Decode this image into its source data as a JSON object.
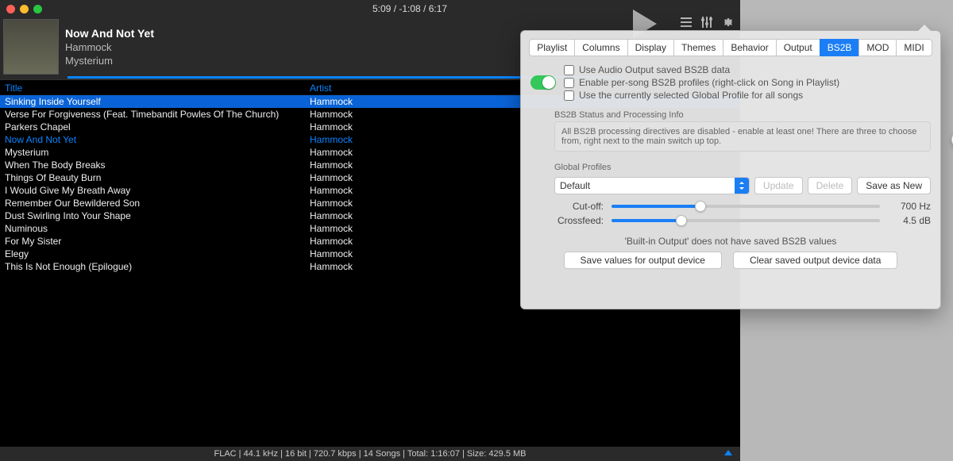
{
  "titlebar": {
    "time_display": "5:09 / -1:08 / 6:17"
  },
  "toolbar_icons": {
    "play": "play-icon",
    "playlist": "list-icon",
    "eq": "equalizer-icon",
    "gear": "gear-icon"
  },
  "now_playing": {
    "title": "Now And Not Yet",
    "artist": "Hammock",
    "album": "Mysterium",
    "progress_pct": 82
  },
  "columns": {
    "title": "Title",
    "artist": "Artist"
  },
  "playlist": [
    {
      "title": "Sinking Inside Yourself",
      "artist": "Hammock",
      "selected": true
    },
    {
      "title": "Verse For Forgiveness (Feat. Timebandit Powles Of The Church)",
      "artist": "Hammock"
    },
    {
      "title": "Parkers Chapel",
      "artist": "Hammock"
    },
    {
      "title": "Now And Not Yet",
      "artist": "Hammock",
      "now_playing": true
    },
    {
      "title": "Mysterium",
      "artist": "Hammock"
    },
    {
      "title": "When The Body Breaks",
      "artist": "Hammock"
    },
    {
      "title": "Things Of Beauty Burn",
      "artist": "Hammock"
    },
    {
      "title": "I Would Give My Breath Away",
      "artist": "Hammock"
    },
    {
      "title": "Remember Our Bewildered Son",
      "artist": "Hammock"
    },
    {
      "title": "Dust Swirling Into Your Shape",
      "artist": "Hammock"
    },
    {
      "title": "Numinous",
      "artist": "Hammock"
    },
    {
      "title": "For My Sister",
      "artist": "Hammock"
    },
    {
      "title": "Elegy",
      "artist": "Hammock"
    },
    {
      "title": "This Is Not Enough  (Epilogue)",
      "artist": "Hammock"
    }
  ],
  "status_bar": "FLAC | 44.1 kHz | 16 bit | 720.7 kbps | 14 Songs | Total: 1:16:07 | Size: 429.5 MB",
  "prefs": {
    "tabs": [
      "Playlist",
      "Columns",
      "Display",
      "Themes",
      "Behavior",
      "Output",
      "BS2B",
      "MOD",
      "MIDI"
    ],
    "active_tab": "BS2B",
    "master_toggle": true,
    "opts": {
      "use_saved": "Use Audio Output saved BS2B data",
      "per_song": "Enable per-song BS2B profiles (right-click on Song in Playlist)",
      "use_global": "Use the currently selected Global Profile for all songs"
    },
    "status_section_label": "BS2B Status and Processing Info",
    "status_info": "All BS2B processing directives are disabled - enable at least one! There are three to choose from, right next to the main switch up top.",
    "profiles_label": "Global Profiles",
    "profile_selected": "Default",
    "buttons": {
      "update": "Update",
      "delete": "Delete",
      "save_new": "Save as New",
      "save_device": "Save values for output device",
      "clear_device": "Clear saved output device data"
    },
    "sliders": {
      "cutoff": {
        "label": "Cut-off:",
        "value": "700 Hz",
        "pct": 33
      },
      "crossfeed": {
        "label": "Crossfeed:",
        "value": "4.5 dB",
        "pct": 26
      }
    },
    "notice": "'Built-in Output' does not have saved BS2B values",
    "help": "?"
  }
}
